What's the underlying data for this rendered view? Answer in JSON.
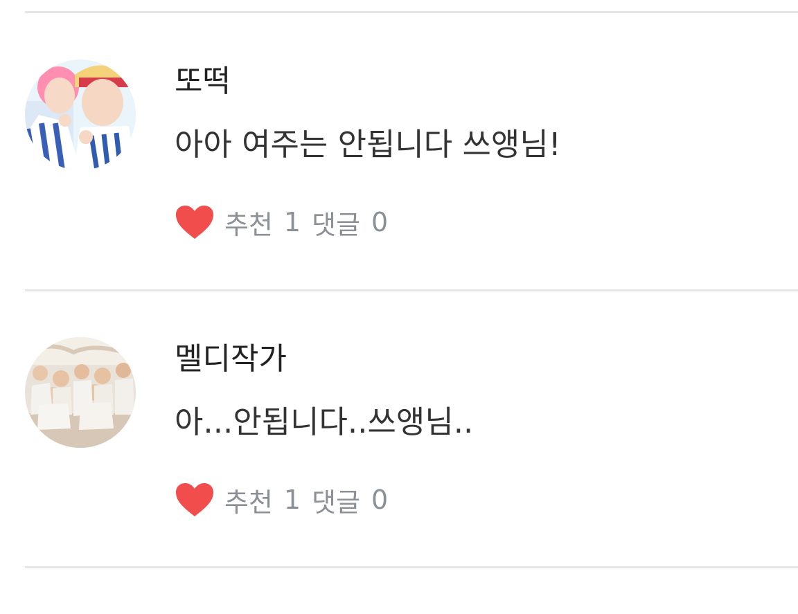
{
  "comments": [
    {
      "author": "또떡",
      "text": "아아 여주는 안됩니다 쓰앵님!",
      "like_label": "추천",
      "like_count": "1",
      "reply_label": "댓글",
      "reply_count": "0"
    },
    {
      "author": "멜디작가",
      "text": "아...안됩니다..쓰앵님..",
      "like_label": "추천",
      "like_count": "1",
      "reply_label": "댓글",
      "reply_count": "0"
    }
  ],
  "colors": {
    "heart": "#f24d4d",
    "meta_text": "#8a9096",
    "divider": "#e5e5e5"
  }
}
